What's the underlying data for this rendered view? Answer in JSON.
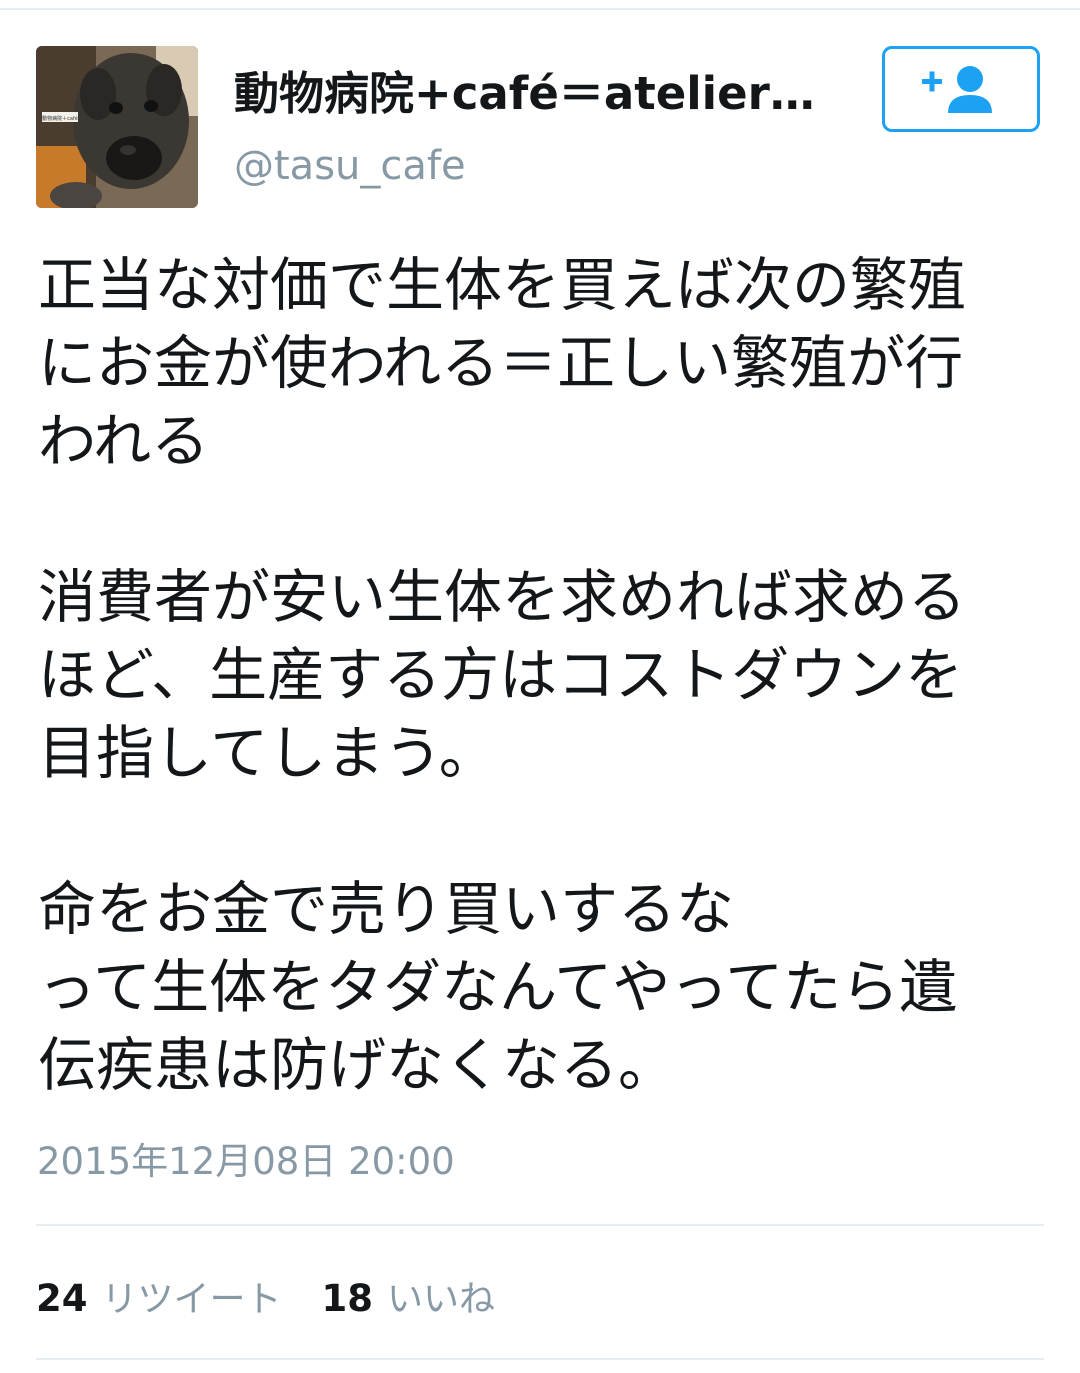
{
  "user": {
    "display_name": "動物病院+café＝atelier…",
    "handle": "@tasu_cafe",
    "avatar_text": "動物病院＋café"
  },
  "follow_button": {
    "icon": "add-user-icon",
    "color": "#1da1f2"
  },
  "tweet": {
    "text": "正当な対価で生体を買えば次の繁殖\nにお金が使われる＝正しい繁殖が行\nわれる\n\n消費者が安い生体を求めれば求める\nほど、生産する方はコストダウンを\n目指してしまう。\n\n命をお金で売り買いするな\nって生体をタダなんてやってたら遺\n伝疾患は防げなくなる。",
    "timestamp": "2015年12月08日 20:00"
  },
  "stats": {
    "retweets": {
      "count": "24",
      "label": "リツイート"
    },
    "likes": {
      "count": "18",
      "label": "いいね"
    }
  },
  "colors": {
    "text": "#14171a",
    "secondary": "#8899a6",
    "accent": "#1da1f2",
    "divider": "#e6ecf0"
  }
}
